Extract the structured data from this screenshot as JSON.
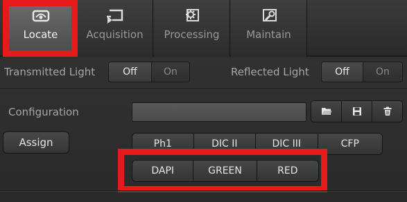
{
  "tabs": [
    {
      "label": "Locate",
      "icon": "eye-icon",
      "active": true
    },
    {
      "label": "Acquisition",
      "icon": "acquisition-icon",
      "active": false
    },
    {
      "label": "Processing",
      "icon": "processing-gear-icon",
      "active": false
    },
    {
      "label": "Maintain",
      "icon": "maintain-wrench-icon",
      "active": false
    }
  ],
  "light": {
    "transmitted_label": "Transmitted Light",
    "transmitted_off": "Off",
    "transmitted_on": "On",
    "reflected_label": "Reflected Light",
    "reflected_off": "Off",
    "reflected_on": "On"
  },
  "configuration": {
    "label": "Configuration",
    "value": "",
    "buttons": [
      "folder-open-icon",
      "save-icon",
      "delete-trash-icon"
    ]
  },
  "assign": {
    "label": "Assign",
    "filters_row1": [
      "Ph1",
      "DIC II",
      "DIC III",
      "CFP"
    ],
    "filters_row2": [
      "DAPI",
      "GREEN",
      "RED"
    ]
  },
  "colors": {
    "highlight": "#e8191b",
    "active_tab": "#5a5a5a",
    "background": "#2e2e2e"
  }
}
